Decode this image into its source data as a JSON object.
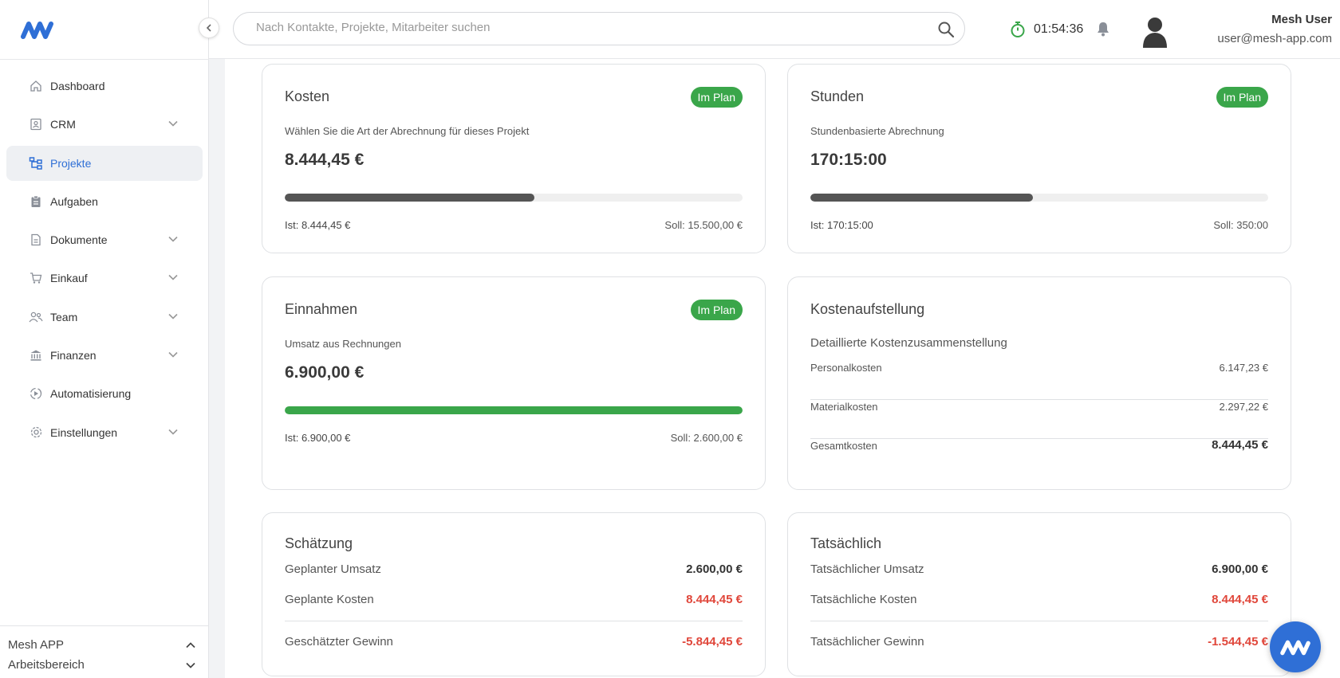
{
  "brand": {
    "accent": "#2f6fd6",
    "success": "#3aa64a",
    "danger": "#e0463a"
  },
  "sidebar": {
    "items": [
      {
        "label": "Dashboard",
        "icon": "home-icon"
      },
      {
        "label": "CRM",
        "icon": "contact-card-icon",
        "expandable": true
      },
      {
        "label": "Projekte",
        "icon": "project-tree-icon",
        "active": true
      },
      {
        "label": "Aufgaben",
        "icon": "clipboard-icon"
      },
      {
        "label": "Dokumente",
        "icon": "document-icon",
        "expandable": true
      },
      {
        "label": "Einkauf",
        "icon": "cart-icon",
        "expandable": true
      },
      {
        "label": "Team",
        "icon": "team-icon",
        "expandable": true
      },
      {
        "label": "Finanzen",
        "icon": "bank-icon",
        "expandable": true
      },
      {
        "label": "Automatisierung",
        "icon": "automation-icon"
      },
      {
        "label": "Einstellungen",
        "icon": "gear-icon",
        "expandable": true
      }
    ],
    "app_name": "Mesh APP",
    "workspace": "Arbeitsbereich"
  },
  "header": {
    "search_placeholder": "Nach Kontakte, Projekte, Mitarbeiter suchen",
    "timer": "01:54:36",
    "user_name": "Mesh User",
    "user_email": "user@mesh-app.com"
  },
  "cards": {
    "kosten": {
      "title": "Kosten",
      "badge": "Im Plan",
      "subtitle": "Wählen Sie die Art der Abrechnung für dieses Projekt",
      "value": "8.444,45 €",
      "progress": 0.545,
      "ist": "Ist: 8.444,45 €",
      "soll": "Soll: 15.500,00 €"
    },
    "stunden": {
      "title": "Stunden",
      "badge": "Im Plan",
      "subtitle": "Stundenbasierte Abrechnung",
      "value": "170:15:00",
      "progress": 0.486,
      "ist": "Ist: 170:15:00",
      "soll": "Soll: 350:00"
    },
    "einnahmen": {
      "title": "Einnahmen",
      "badge": "Im Plan",
      "subtitle": "Umsatz aus Rechnungen",
      "value": "6.900,00 €",
      "progress": 1.0,
      "ist": "Ist: 6.900,00 €",
      "soll": "Soll: 2.600,00 €"
    },
    "kostenaufstellung": {
      "title": "Kostenaufstellung",
      "subtitle": "Detaillierte Kostenzusammenstellung",
      "rows": [
        {
          "label": "Personalkosten",
          "value": "6.147,23 €"
        },
        {
          "label": "Materialkosten",
          "value": "2.297,22 €"
        },
        {
          "label": "Gesamtkosten",
          "value": "8.444,45 €"
        }
      ]
    },
    "schaetzung": {
      "title": "Schätzung",
      "rows": [
        {
          "label": "Geplanter Umsatz",
          "value": "2.600,00 €"
        },
        {
          "label": "Geplante Kosten",
          "value": "8.444,45 €"
        },
        {
          "label": "Geschätzter Gewinn",
          "value": "-5.844,45 €"
        }
      ]
    },
    "tatsaechlich": {
      "title": "Tatsächlich",
      "rows": [
        {
          "label": "Tatsächlicher Umsatz",
          "value": "6.900,00 €"
        },
        {
          "label": "Tatsächliche Kosten",
          "value": "8.444,45 €"
        },
        {
          "label": "Tatsächlicher Gewinn",
          "value": "-1.544,45 €"
        }
      ]
    }
  }
}
